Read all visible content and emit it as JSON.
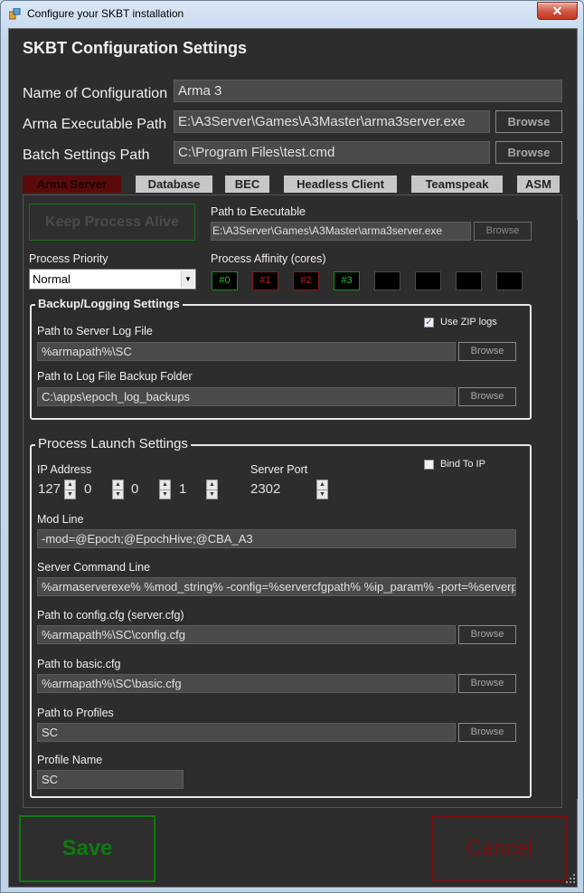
{
  "window": {
    "title": "Configure your SKBT installation",
    "close_glyph": "✕"
  },
  "header": {
    "title": "SKBT Configuration Settings"
  },
  "config": {
    "name_label": "Name of Configuration",
    "name_value": "Arma 3",
    "exe_label": "Arma Executable Path",
    "exe_value": "E:\\A3Server\\Games\\A3Master\\arma3server.exe",
    "batch_label": "Batch Settings Path",
    "batch_value": "C:\\Program Files\\test.cmd",
    "browse": "Browse"
  },
  "tabs": [
    "Arma Server",
    "Database",
    "BEC",
    "Headless Client",
    "Teamspeak",
    "ASM"
  ],
  "arma": {
    "keep_alive": "Keep Process Alive",
    "path_label": "Path to Executable",
    "path_value": "E:\\A3Server\\Games\\A3Master\\arma3server.exe",
    "priority_label": "Process Priority",
    "priority_value": "Normal",
    "affinity_label": "Process Affinity (cores)",
    "cores": [
      "#0",
      "#1",
      "#2",
      "#3",
      "",
      "",
      "",
      ""
    ]
  },
  "backup": {
    "title": "Backup/Logging Settings",
    "use_zip": "Use ZIP logs",
    "log_label": "Path to Server Log File",
    "log_value": "%armapath%\\SC",
    "folder_label": "Path to Log File Backup Folder",
    "folder_value": "C:\\apps\\epoch_log_backups"
  },
  "launch": {
    "title": "Process Launch Settings",
    "ip_label": "IP Address",
    "ip": [
      "127",
      "0",
      "0",
      "1"
    ],
    "port_label": "Server Port",
    "port_value": "2302",
    "bind_ip": "Bind To IP",
    "mod_label": "Mod Line",
    "mod_value": "-mod=@Epoch;@EpochHive;@CBA_A3",
    "cmd_label": "Server Command Line",
    "cmd_value": "%armaserverexe% %mod_string% -config=%servercfgpath% %ip_param% -port=%serverport%",
    "cfg_label": "Path to config.cfg (server.cfg)",
    "cfg_value": "%armapath%\\SC\\config.cfg",
    "basic_label": "Path to basic.cfg",
    "basic_value": "%armapath%\\SC\\basic.cfg",
    "profiles_label": "Path to Profiles",
    "profiles_value": "SC",
    "profile_name_label": "Profile Name",
    "profile_name_value": "SC"
  },
  "actions": {
    "save": "Save",
    "cancel": "Cancel"
  },
  "colors": {
    "save_green": "#0f7a0f",
    "cancel_red": "#7a0e0e",
    "active_tab": "#5a0a0a"
  }
}
